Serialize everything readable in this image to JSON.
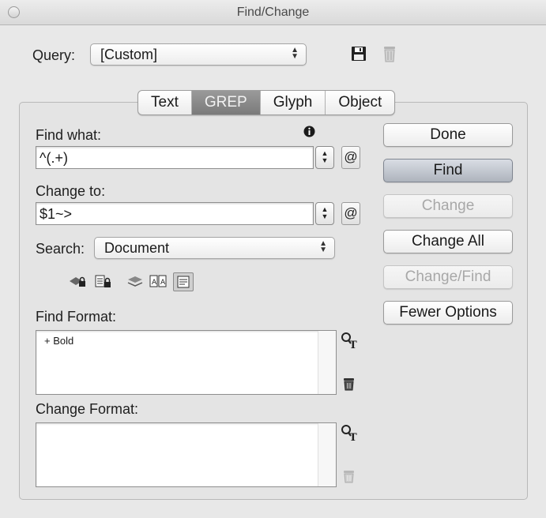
{
  "window": {
    "title": "Find/Change"
  },
  "query": {
    "label": "Query:",
    "value": "[Custom]"
  },
  "tabs": [
    {
      "label": "Text",
      "active": false
    },
    {
      "label": "GREP",
      "active": true
    },
    {
      "label": "Glyph",
      "active": false
    },
    {
      "label": "Object",
      "active": false
    }
  ],
  "find_what": {
    "label": "Find what:",
    "value": "^(.+)"
  },
  "change_to": {
    "label": "Change to:",
    "value": "$1~>"
  },
  "search": {
    "label": "Search:",
    "value": "Document"
  },
  "find_format": {
    "label": "Find Format:",
    "value": "+ Bold"
  },
  "change_format": {
    "label": "Change Format:",
    "value": ""
  },
  "buttons": {
    "done": "Done",
    "find": "Find",
    "change": "Change",
    "change_all": "Change All",
    "change_find": "Change/Find",
    "fewer_options": "Fewer Options"
  },
  "icons": {
    "save_query": "floppy-disk-icon",
    "delete_query": "trash-icon",
    "info": "info-icon",
    "special_chars": "at-sign-icon",
    "specify_format": "format-search-icon",
    "clear_format": "trash-icon"
  }
}
